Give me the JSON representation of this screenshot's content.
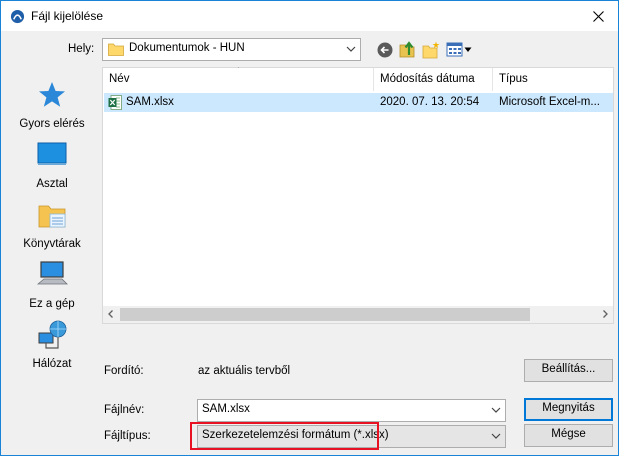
{
  "window": {
    "title": "Fájl kijelölése"
  },
  "location": {
    "label": "Hely:",
    "value": "Dokumentumok - HUN"
  },
  "toolbar": {
    "back_icon": "back-arrow-icon",
    "up_icon": "up-folder-icon",
    "new_folder_icon": "new-folder-icon",
    "view_icon": "view-menu-icon"
  },
  "places": [
    {
      "label": "Gyors elérés",
      "icon": "star-icon"
    },
    {
      "label": "Asztal",
      "icon": "desktop-icon"
    },
    {
      "label": "Könyvtárak",
      "icon": "libraries-icon"
    },
    {
      "label": "Ez a gép",
      "icon": "computer-icon"
    },
    {
      "label": "Hálózat",
      "icon": "network-icon"
    }
  ],
  "filelist": {
    "columns": [
      "Név",
      "Módosítás dátuma",
      "Típus"
    ],
    "rows": [
      {
        "name": "SAM.xlsx",
        "date": "2020. 07. 13. 20:54",
        "type": "Microsoft Excel-m..."
      }
    ]
  },
  "translator": {
    "label": "Fordító:",
    "value": "az aktuális tervből"
  },
  "settings_button": "Beállítás...",
  "filename": {
    "label": "Fájlnév:",
    "value": "SAM.xlsx"
  },
  "filetype": {
    "label": "Fájltípus:",
    "value": "Szerkezetelemzési formátum (*.xlsx)"
  },
  "open_button": "Megnyitás",
  "cancel_button": "Mégse",
  "colors": {
    "accent": "#0078d7",
    "selection": "#cce8ff",
    "highlight": "#e81123"
  }
}
